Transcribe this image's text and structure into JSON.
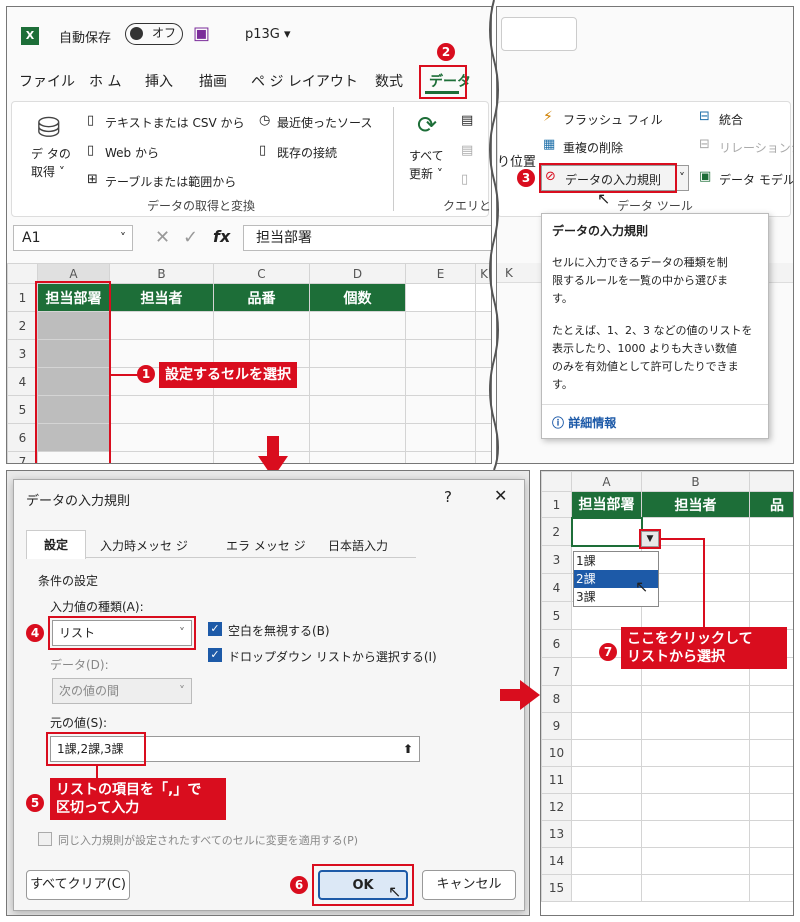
{
  "excel": {
    "logo": "X",
    "autosave": "自動保存",
    "toggle": "オフ",
    "filename": "p13G ▾",
    "tabs": [
      "ファイル",
      "ホ ム",
      "挿入",
      "描画",
      "ペ ジ レイアウト",
      "数式",
      "データ"
    ],
    "get_data_btn": "デ タの\n取得 ˅",
    "ribbon_items": [
      "テキストまたは CSV から",
      "Web から",
      "テーブルまたは範囲から"
    ],
    "ribbon_items2": [
      "最近使ったソース",
      "既存の接続"
    ],
    "group1": "データの取得と変換",
    "refresh_btn": "すべて\n更新 ˅",
    "group2": "クエリと",
    "partial_pos": "り位置",
    "flash_fill": "フラッシュ フィル",
    "consolidate": "統合",
    "remove_dup": "重複の削除",
    "relations": "リレーションシ",
    "data_validation": "データの入力規則",
    "data_model": "データ モデル",
    "group3": "データ ツール",
    "namebox": "A1",
    "fx": "fx",
    "formula": "担当部署",
    "cols": [
      "A",
      "B",
      "C",
      "D",
      "E",
      "K"
    ],
    "headers": [
      "担当部署",
      "担当者",
      "品番",
      "個数"
    ],
    "rows": [
      "1",
      "2",
      "3",
      "4",
      "5",
      "6",
      "7"
    ]
  },
  "tooltip": {
    "title": "データの入力規則",
    "line1": "セルに入力できるデータの種類を制",
    "line2": "限するルールを一覧の中から選びま",
    "line3": "す。",
    "line4": "たとえば、1、2、3 などの値のリストを",
    "line5": "表示したり、1000 よりも大きい数値",
    "line6": "のみを有効値として許可したりできま",
    "line7": "す。",
    "more": "詳細情報"
  },
  "dialog": {
    "title": "データの入力規則",
    "help": "?",
    "close": "✕",
    "tabs": [
      "設定",
      "入力時メッセ ジ",
      "エラ メッセ ジ",
      "日本語入力"
    ],
    "section": "条件の設定",
    "type_label": "入力値の種類(A):",
    "type_value": "リスト",
    "ignore_blank": "空白を無視する(B)",
    "dropdown": "ドロップダウン リストから選択する(I)",
    "data_label": "データ(D):",
    "data_value": "次の値の間",
    "source_label": "元の値(S):",
    "source_value": "1課,2課,3課",
    "apply_all": "同じ入力規則が設定されたすべてのセルに変更を適用する(P)",
    "clear_all": "すべてクリア(C)",
    "ok": "OK",
    "cancel": "キャンセル"
  },
  "result": {
    "cols": [
      "A",
      "B"
    ],
    "headers": [
      "担当部署",
      "担当者",
      "品"
    ],
    "rows": [
      "1",
      "2",
      "3",
      "4",
      "5",
      "6",
      "7",
      "8",
      "9",
      "10",
      "11",
      "12",
      "13",
      "14",
      "15"
    ],
    "options": [
      "1課",
      "2課",
      "3課"
    ]
  },
  "callouts": {
    "n1": "1",
    "c1": "設定するセルを選択",
    "n2": "2",
    "n3": "3",
    "n4": "4",
    "n5": "5",
    "c5a": "リストの項目を「,」で",
    "c5b": "区切って入力",
    "n6": "6",
    "n7": "7",
    "c7a": "ここをクリックして",
    "c7b": "リストから選択"
  }
}
